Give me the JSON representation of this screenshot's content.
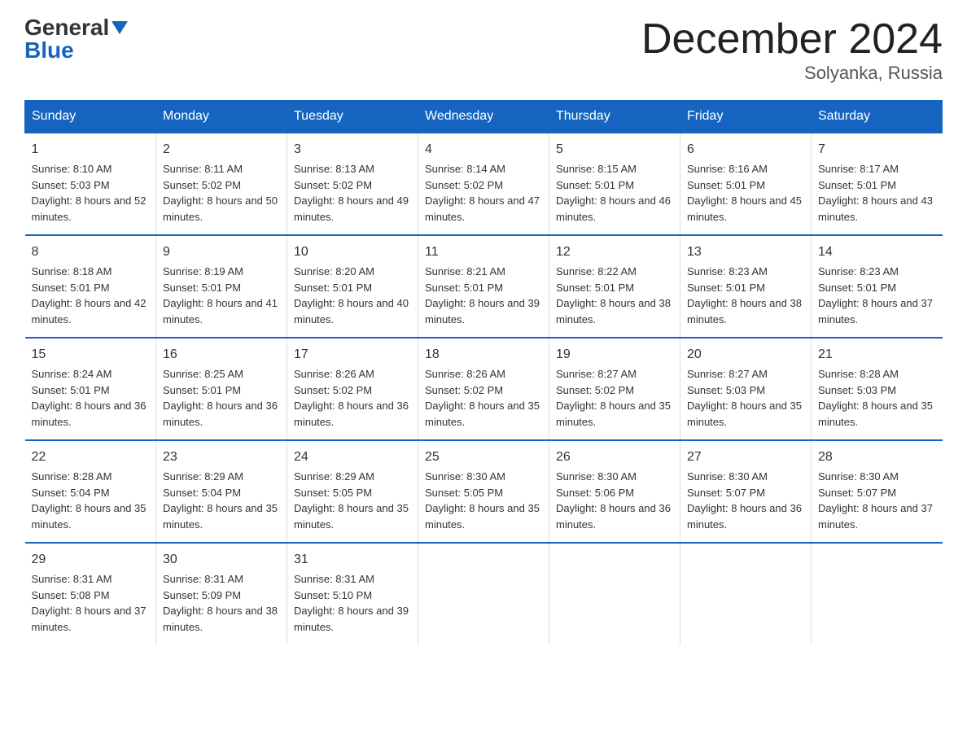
{
  "header": {
    "title": "December 2024",
    "subtitle": "Solyanka, Russia",
    "logo_general": "General",
    "logo_blue": "Blue"
  },
  "days_of_week": [
    "Sunday",
    "Monday",
    "Tuesday",
    "Wednesday",
    "Thursday",
    "Friday",
    "Saturday"
  ],
  "weeks": [
    [
      {
        "day": "1",
        "sunrise": "8:10 AM",
        "sunset": "5:03 PM",
        "daylight": "8 hours and 52 minutes."
      },
      {
        "day": "2",
        "sunrise": "8:11 AM",
        "sunset": "5:02 PM",
        "daylight": "8 hours and 50 minutes."
      },
      {
        "day": "3",
        "sunrise": "8:13 AM",
        "sunset": "5:02 PM",
        "daylight": "8 hours and 49 minutes."
      },
      {
        "day": "4",
        "sunrise": "8:14 AM",
        "sunset": "5:02 PM",
        "daylight": "8 hours and 47 minutes."
      },
      {
        "day": "5",
        "sunrise": "8:15 AM",
        "sunset": "5:01 PM",
        "daylight": "8 hours and 46 minutes."
      },
      {
        "day": "6",
        "sunrise": "8:16 AM",
        "sunset": "5:01 PM",
        "daylight": "8 hours and 45 minutes."
      },
      {
        "day": "7",
        "sunrise": "8:17 AM",
        "sunset": "5:01 PM",
        "daylight": "8 hours and 43 minutes."
      }
    ],
    [
      {
        "day": "8",
        "sunrise": "8:18 AM",
        "sunset": "5:01 PM",
        "daylight": "8 hours and 42 minutes."
      },
      {
        "day": "9",
        "sunrise": "8:19 AM",
        "sunset": "5:01 PM",
        "daylight": "8 hours and 41 minutes."
      },
      {
        "day": "10",
        "sunrise": "8:20 AM",
        "sunset": "5:01 PM",
        "daylight": "8 hours and 40 minutes."
      },
      {
        "day": "11",
        "sunrise": "8:21 AM",
        "sunset": "5:01 PM",
        "daylight": "8 hours and 39 minutes."
      },
      {
        "day": "12",
        "sunrise": "8:22 AM",
        "sunset": "5:01 PM",
        "daylight": "8 hours and 38 minutes."
      },
      {
        "day": "13",
        "sunrise": "8:23 AM",
        "sunset": "5:01 PM",
        "daylight": "8 hours and 38 minutes."
      },
      {
        "day": "14",
        "sunrise": "8:23 AM",
        "sunset": "5:01 PM",
        "daylight": "8 hours and 37 minutes."
      }
    ],
    [
      {
        "day": "15",
        "sunrise": "8:24 AM",
        "sunset": "5:01 PM",
        "daylight": "8 hours and 36 minutes."
      },
      {
        "day": "16",
        "sunrise": "8:25 AM",
        "sunset": "5:01 PM",
        "daylight": "8 hours and 36 minutes."
      },
      {
        "day": "17",
        "sunrise": "8:26 AM",
        "sunset": "5:02 PM",
        "daylight": "8 hours and 36 minutes."
      },
      {
        "day": "18",
        "sunrise": "8:26 AM",
        "sunset": "5:02 PM",
        "daylight": "8 hours and 35 minutes."
      },
      {
        "day": "19",
        "sunrise": "8:27 AM",
        "sunset": "5:02 PM",
        "daylight": "8 hours and 35 minutes."
      },
      {
        "day": "20",
        "sunrise": "8:27 AM",
        "sunset": "5:03 PM",
        "daylight": "8 hours and 35 minutes."
      },
      {
        "day": "21",
        "sunrise": "8:28 AM",
        "sunset": "5:03 PM",
        "daylight": "8 hours and 35 minutes."
      }
    ],
    [
      {
        "day": "22",
        "sunrise": "8:28 AM",
        "sunset": "5:04 PM",
        "daylight": "8 hours and 35 minutes."
      },
      {
        "day": "23",
        "sunrise": "8:29 AM",
        "sunset": "5:04 PM",
        "daylight": "8 hours and 35 minutes."
      },
      {
        "day": "24",
        "sunrise": "8:29 AM",
        "sunset": "5:05 PM",
        "daylight": "8 hours and 35 minutes."
      },
      {
        "day": "25",
        "sunrise": "8:30 AM",
        "sunset": "5:05 PM",
        "daylight": "8 hours and 35 minutes."
      },
      {
        "day": "26",
        "sunrise": "8:30 AM",
        "sunset": "5:06 PM",
        "daylight": "8 hours and 36 minutes."
      },
      {
        "day": "27",
        "sunrise": "8:30 AM",
        "sunset": "5:07 PM",
        "daylight": "8 hours and 36 minutes."
      },
      {
        "day": "28",
        "sunrise": "8:30 AM",
        "sunset": "5:07 PM",
        "daylight": "8 hours and 37 minutes."
      }
    ],
    [
      {
        "day": "29",
        "sunrise": "8:31 AM",
        "sunset": "5:08 PM",
        "daylight": "8 hours and 37 minutes."
      },
      {
        "day": "30",
        "sunrise": "8:31 AM",
        "sunset": "5:09 PM",
        "daylight": "8 hours and 38 minutes."
      },
      {
        "day": "31",
        "sunrise": "8:31 AM",
        "sunset": "5:10 PM",
        "daylight": "8 hours and 39 minutes."
      },
      null,
      null,
      null,
      null
    ]
  ]
}
